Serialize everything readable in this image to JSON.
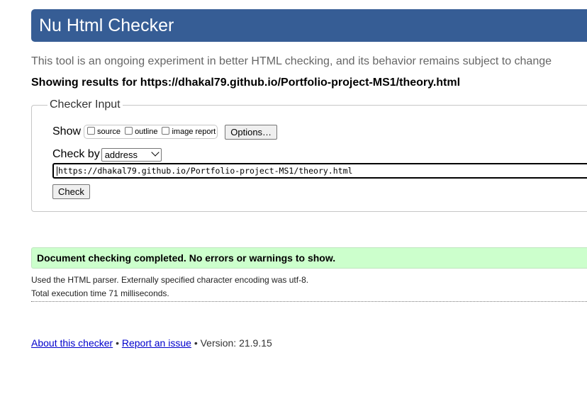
{
  "header": {
    "title": "Nu Html Checker"
  },
  "tagline": "This tool is an ongoing experiment in better HTML checking, and its behavior remains subject to change",
  "showing_results": "Showing results for https://dhakal79.github.io/Portfolio-project-MS1/theory.html",
  "checker_input": {
    "legend": "Checker Input",
    "show_label": "Show",
    "show_options": [
      {
        "label": "source",
        "checked": false
      },
      {
        "label": "outline",
        "checked": false
      },
      {
        "label": "image report",
        "checked": false
      }
    ],
    "options_button": "Options…",
    "check_by_label": "Check by",
    "check_by_value": "address",
    "url_value": "https://dhakal79.github.io/Portfolio-project-MS1/theory.html",
    "check_button": "Check"
  },
  "result": {
    "success_message": "Document checking completed. No errors or warnings to show.",
    "parser_info": "Used the HTML parser. Externally specified character encoding was utf-8.",
    "execution_time": "Total execution time 71 milliseconds."
  },
  "footer": {
    "about_link": "About this checker",
    "separator": "•",
    "report_link": "Report an issue",
    "version": "Version: 21.9.15"
  },
  "colors": {
    "header_bg": "#365d95",
    "success_bg": "#ccffcc",
    "link": "#0000cc"
  }
}
